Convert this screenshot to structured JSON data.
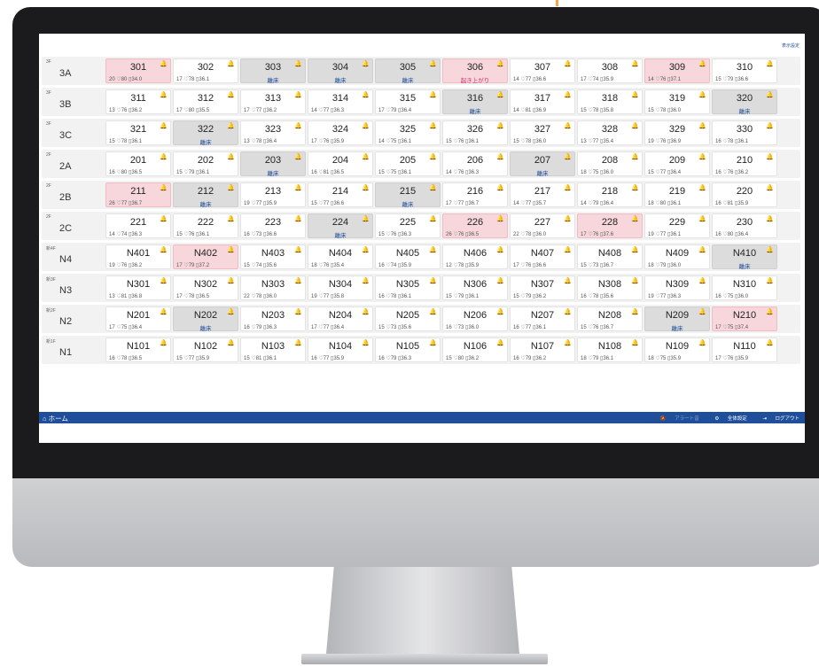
{
  "header": {
    "settings_label": "表示設定"
  },
  "footer": {
    "home_label": "ホーム",
    "alert_label": "アラート音",
    "general_settings_label": "全体設定",
    "logout_label": "ログアウト"
  },
  "status_labels": {
    "away": "離床",
    "up": "起き上がり"
  },
  "colors": {
    "accent": "#1f4f9a",
    "alert_bg": "#f7d7dc",
    "away_bg": "#dcdcdc",
    "warn_text": "#e0762c"
  },
  "rows": [
    {
      "floor": "3F",
      "unit": "3A",
      "rooms": [
        {
          "room": "301",
          "vitals": "20 ♡80 ▯34.0",
          "status": "alert"
        },
        {
          "room": "302",
          "vitals": "17 ♡78 ▯36.1",
          "status": "normal"
        },
        {
          "room": "303",
          "label": "離床",
          "status": "away"
        },
        {
          "room": "304",
          "label": "離床",
          "status": "away"
        },
        {
          "room": "305",
          "label": "離床",
          "status": "away"
        },
        {
          "room": "306",
          "label": "起き上がり",
          "status": "alert"
        },
        {
          "room": "307",
          "vitals": "14 ♡77 ▯36.6",
          "status": "normal"
        },
        {
          "room": "308",
          "vitals": "17 ♡74 ▯35.9",
          "status": "normal"
        },
        {
          "room": "309",
          "vitals": "14 ♡76 ▯37.1",
          "status": "alert"
        },
        {
          "room": "310",
          "vitals": "15 ♡79 ▯36.6",
          "status": "normal"
        }
      ]
    },
    {
      "floor": "3F",
      "unit": "3B",
      "rooms": [
        {
          "room": "311",
          "vitals": "13 ♡76 ▯36.2",
          "status": "normal"
        },
        {
          "room": "312",
          "vitals": "17 ♡80 ▯35.5",
          "status": "normal"
        },
        {
          "room": "313",
          "vitals": "17 ♡77 ▯36.2",
          "status": "normal"
        },
        {
          "room": "314",
          "vitals": "14 ♡77 ▯36.3",
          "status": "normal"
        },
        {
          "room": "315",
          "vitals": "17 ♡79 ▯36.4",
          "status": "normal"
        },
        {
          "room": "316",
          "label": "離床",
          "status": "away"
        },
        {
          "room": "317",
          "vitals": "14 ♡81 ▯36.9",
          "status": "normal"
        },
        {
          "room": "318",
          "vitals": "15 ♡78 ▯35.8",
          "status": "normal"
        },
        {
          "room": "319",
          "vitals": "15 ♡78 ▯36.0",
          "status": "normal"
        },
        {
          "room": "320",
          "label": "離床",
          "status": "away"
        }
      ]
    },
    {
      "floor": "3F",
      "unit": "3C",
      "rooms": [
        {
          "room": "321",
          "vitals": "15 ♡78 ▯36.1",
          "status": "normal"
        },
        {
          "room": "322",
          "label": "離床",
          "status": "away"
        },
        {
          "room": "323",
          "vitals": "13 ♡78 ▯36.4",
          "status": "normal"
        },
        {
          "room": "324",
          "vitals": "17 ♡76 ▯35.9",
          "status": "normal"
        },
        {
          "room": "325",
          "vitals": "14 ♡75 ▯36.1",
          "status": "normal"
        },
        {
          "room": "326",
          "vitals": "15 ♡76 ▯36.1",
          "status": "normal"
        },
        {
          "room": "327",
          "vitals": "15 ♡78 ▯36.0",
          "status": "normal"
        },
        {
          "room": "328",
          "vitals": "13 ♡77 ▯35.4",
          "status": "normal"
        },
        {
          "room": "329",
          "vitals": "19 ♡76 ▯36.9",
          "status": "normal"
        },
        {
          "room": "330",
          "vitals": "16 ♡78 ▯36.1",
          "status": "normal"
        }
      ]
    },
    {
      "floor": "2F",
      "unit": "2A",
      "rooms": [
        {
          "room": "201",
          "vitals": "16 ♡80 ▯36.5",
          "status": "normal"
        },
        {
          "room": "202",
          "vitals": "15 ♡79 ▯36.1",
          "status": "normal"
        },
        {
          "room": "203",
          "label": "離床",
          "status": "away"
        },
        {
          "room": "204",
          "vitals": "16 ♡81 ▯36.5",
          "status": "normal"
        },
        {
          "room": "205",
          "vitals": "15 ♡75 ▯36.1",
          "status": "normal"
        },
        {
          "room": "206",
          "vitals": "14 ♡76 ▯36.3",
          "status": "normal"
        },
        {
          "room": "207",
          "label": "離床",
          "status": "away"
        },
        {
          "room": "208",
          "vitals": "18 ♡75 ▯36.0",
          "status": "normal"
        },
        {
          "room": "209",
          "vitals": "15 ♡77 ▯36.4",
          "status": "normal"
        },
        {
          "room": "210",
          "vitals": "16 ♡76 ▯36.2",
          "status": "normal"
        }
      ]
    },
    {
      "floor": "2F",
      "unit": "2B",
      "rooms": [
        {
          "room": "211",
          "vitals": "26 ♡77 ▯36.7",
          "status": "alert"
        },
        {
          "room": "212",
          "label": "離床",
          "status": "away"
        },
        {
          "room": "213",
          "vitals": "19 ♡77 ▯35.9",
          "status": "normal"
        },
        {
          "room": "214",
          "vitals": "15 ♡77 ▯36.6",
          "status": "normal"
        },
        {
          "room": "215",
          "label": "離床",
          "status": "away"
        },
        {
          "room": "216",
          "vitals": "17 ♡77 ▯36.7",
          "status": "normal"
        },
        {
          "room": "217",
          "vitals": "14 ♡77 ▯35.7",
          "status": "normal"
        },
        {
          "room": "218",
          "vitals": "14 ♡79 ▯36.4",
          "status": "normal"
        },
        {
          "room": "219",
          "vitals": "18 ♡80 ▯36.1",
          "status": "normal"
        },
        {
          "room": "220",
          "vitals": "16 ♡81 ▯35.9",
          "status": "normal"
        }
      ]
    },
    {
      "floor": "2F",
      "unit": "2C",
      "rooms": [
        {
          "room": "221",
          "vitals": "14 ♡74 ▯36.3",
          "status": "normal"
        },
        {
          "room": "222",
          "vitals": "15 ♡76 ▯36.1",
          "status": "normal"
        },
        {
          "room": "223",
          "vitals": "16 ♡73 ▯36.6",
          "status": "normal"
        },
        {
          "room": "224",
          "label": "離床",
          "status": "away"
        },
        {
          "room": "225",
          "vitals": "15 ♡76 ▯36.3",
          "status": "normal"
        },
        {
          "room": "226",
          "vitals": "26 ♡76 ▯36.5",
          "status": "alert"
        },
        {
          "room": "227",
          "vitals": "22 ♡78 ▯36.0",
          "status": "normal"
        },
        {
          "room": "228",
          "vitals": "17 ♡76 ▯37.6",
          "status": "alert"
        },
        {
          "room": "229",
          "vitals": "19 ♡77 ▯36.1",
          "status": "normal"
        },
        {
          "room": "230",
          "vitals": "16 ♡80 ▯36.4",
          "status": "normal"
        }
      ]
    },
    {
      "floor": "新4F",
      "unit": "N4",
      "rooms": [
        {
          "room": "N401",
          "vitals": "19 ♡76 ▯36.2",
          "status": "normal"
        },
        {
          "room": "N402",
          "vitals": "17 ♡79 ▯37.2",
          "status": "alert"
        },
        {
          "room": "N403",
          "vitals": "15 ♡74 ▯35.6",
          "status": "normal"
        },
        {
          "room": "N404",
          "vitals": "18 ♡76 ▯35.4",
          "status": "normal"
        },
        {
          "room": "N405",
          "vitals": "16 ♡74 ▯35.9",
          "status": "normal"
        },
        {
          "room": "N406",
          "vitals": "12 ♡78 ▯35.9",
          "status": "normal"
        },
        {
          "room": "N407",
          "vitals": "17 ♡76 ▯36.6",
          "status": "normal"
        },
        {
          "room": "N408",
          "vitals": "15 ♡73 ▯36.7",
          "status": "normal"
        },
        {
          "room": "N409",
          "vitals": "18 ♡79 ▯36.0",
          "status": "normal"
        },
        {
          "room": "N410",
          "label": "離床",
          "status": "away"
        }
      ]
    },
    {
      "floor": "新3F",
      "unit": "N3",
      "rooms": [
        {
          "room": "N301",
          "vitals": "13 ♡81 ▯36.8",
          "status": "normal"
        },
        {
          "room": "N302",
          "vitals": "17 ♡78 ▯36.5",
          "status": "normal"
        },
        {
          "room": "N303",
          "vitals": "22 ♡78 ▯36.0",
          "status": "normal"
        },
        {
          "room": "N304",
          "vitals": "19 ♡77 ▯35.8",
          "status": "normal"
        },
        {
          "room": "N305",
          "vitals": "16 ♡78 ▯36.1",
          "status": "normal"
        },
        {
          "room": "N306",
          "vitals": "15 ♡79 ▯36.1",
          "status": "normal"
        },
        {
          "room": "N307",
          "vitals": "15 ♡79 ▯36.2",
          "status": "normal"
        },
        {
          "room": "N308",
          "vitals": "16 ♡78 ▯35.6",
          "status": "normal"
        },
        {
          "room": "N309",
          "vitals": "19 ♡77 ▯36.3",
          "status": "normal"
        },
        {
          "room": "N310",
          "vitals": "16 ♡75 ▯36.0",
          "status": "normal"
        }
      ]
    },
    {
      "floor": "新2F",
      "unit": "N2",
      "rooms": [
        {
          "room": "N201",
          "vitals": "17 ♡75 ▯36.4",
          "status": "normal"
        },
        {
          "room": "N202",
          "label": "離床",
          "status": "away"
        },
        {
          "room": "N203",
          "vitals": "16 ♡79 ▯36.3",
          "status": "normal"
        },
        {
          "room": "N204",
          "vitals": "17 ♡77 ▯36.4",
          "status": "normal"
        },
        {
          "room": "N205",
          "vitals": "15 ♡73 ▯35.6",
          "status": "normal"
        },
        {
          "room": "N206",
          "vitals": "16 ♡73 ▯36.0",
          "status": "normal"
        },
        {
          "room": "N207",
          "vitals": "16 ♡77 ▯36.1",
          "status": "normal"
        },
        {
          "room": "N208",
          "vitals": "15 ♡76 ▯36.7",
          "status": "normal"
        },
        {
          "room": "N209",
          "label": "離床",
          "status": "away"
        },
        {
          "room": "N210",
          "vitals": "17 ♡75 ▯37.4",
          "status": "alert"
        }
      ]
    },
    {
      "floor": "新1F",
      "unit": "N1",
      "rooms": [
        {
          "room": "N101",
          "vitals": "16 ♡78 ▯36.5",
          "status": "normal"
        },
        {
          "room": "N102",
          "vitals": "15 ♡77 ▯35.9",
          "status": "normal"
        },
        {
          "room": "N103",
          "vitals": "15 ♡81 ▯36.1",
          "status": "normal"
        },
        {
          "room": "N104",
          "vitals": "16 ♡77 ▯35.9",
          "status": "normal"
        },
        {
          "room": "N105",
          "vitals": "16 ♡79 ▯36.3",
          "status": "normal"
        },
        {
          "room": "N106",
          "vitals": "15 ♡80 ▯36.2",
          "status": "normal"
        },
        {
          "room": "N107",
          "vitals": "16 ♡79 ▯36.2",
          "status": "normal"
        },
        {
          "room": "N108",
          "vitals": "18 ♡79 ▯36.1",
          "status": "normal"
        },
        {
          "room": "N109",
          "vitals": "18 ♡75 ▯35.9",
          "status": "normal"
        },
        {
          "room": "N110",
          "vitals": "17 ♡76 ▯35.9",
          "status": "normal"
        }
      ]
    }
  ]
}
